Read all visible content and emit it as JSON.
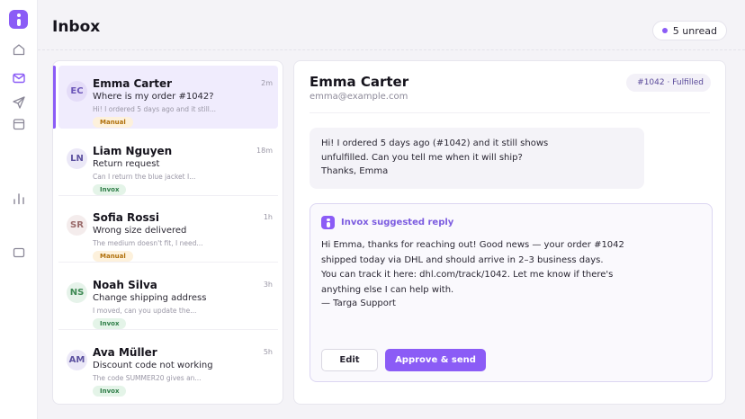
{
  "app": {
    "accent_color": "#8b5cf6"
  },
  "sidebar": {
    "items": [
      {
        "icon": "home-icon"
      },
      {
        "icon": "mail-icon",
        "active": true
      },
      {
        "icon": "send-icon"
      },
      {
        "icon": "calendar-icon"
      },
      {
        "icon": "bar-chart-icon"
      },
      {
        "icon": "window-icon"
      }
    ]
  },
  "header": {
    "title": "Inbox",
    "unread_label": "5 unread"
  },
  "conversations": [
    {
      "initials": "EC",
      "name": "Emma Carter",
      "subject": "Where is my order #1042?",
      "preview": "Hi! I ordered 5 days ago and it still...",
      "time": "2m",
      "tag": "Manual",
      "tag_type": "manual",
      "avatar_bg": "#e4dcf8",
      "avatar_color": "#6b55b8",
      "active": true
    },
    {
      "initials": "LN",
      "name": "Liam Nguyen",
      "subject": "Return request",
      "preview": "Can I return the blue jacket I...",
      "time": "18m",
      "tag": "Invox",
      "tag_type": "invox",
      "avatar_bg": "#ebe8f7",
      "avatar_color": "#5d52a0"
    },
    {
      "initials": "SR",
      "name": "Sofia Rossi",
      "subject": "Wrong size delivered",
      "preview": "The medium doesn't fit, I need...",
      "time": "1h",
      "tag": "Manual",
      "tag_type": "manual",
      "avatar_bg": "#f4ecec",
      "avatar_color": "#9a6b6b"
    },
    {
      "initials": "NS",
      "name": "Noah Silva",
      "subject": "Change shipping address",
      "preview": "I moved, can you update the...",
      "time": "3h",
      "tag": "Invox",
      "tag_type": "invox",
      "avatar_bg": "#e6f3ea",
      "avatar_color": "#3f8a55"
    },
    {
      "initials": "AM",
      "name": "Ava Müller",
      "subject": "Discount code not working",
      "preview": "The code SUMMER20 gives an...",
      "time": "5h",
      "tag": "Invox",
      "tag_type": "invox",
      "avatar_bg": "#ebe8f7",
      "avatar_color": "#5d52a0"
    }
  ],
  "detail": {
    "name": "Emma Carter",
    "email": "emma@example.com",
    "order_badge": "#1042 · Fulfilled",
    "message_lines": [
      "Hi! I ordered 5 days ago (#1042) and it still shows",
      "unfulfilled. Can you tell me when it will ship?",
      "Thanks, Emma"
    ],
    "suggestion": {
      "title": "Invox suggested reply",
      "lines": [
        "Hi Emma, thanks for reaching out! Good news — your order #1042",
        "shipped today via DHL and should arrive in 2–3 business days.",
        "You can track it here: dhl.com/track/1042. Let me know if there's",
        "anything else I can help with."
      ],
      "signature": "— Targa Support",
      "edit_label": "Edit",
      "send_label": "Approve & send"
    }
  }
}
